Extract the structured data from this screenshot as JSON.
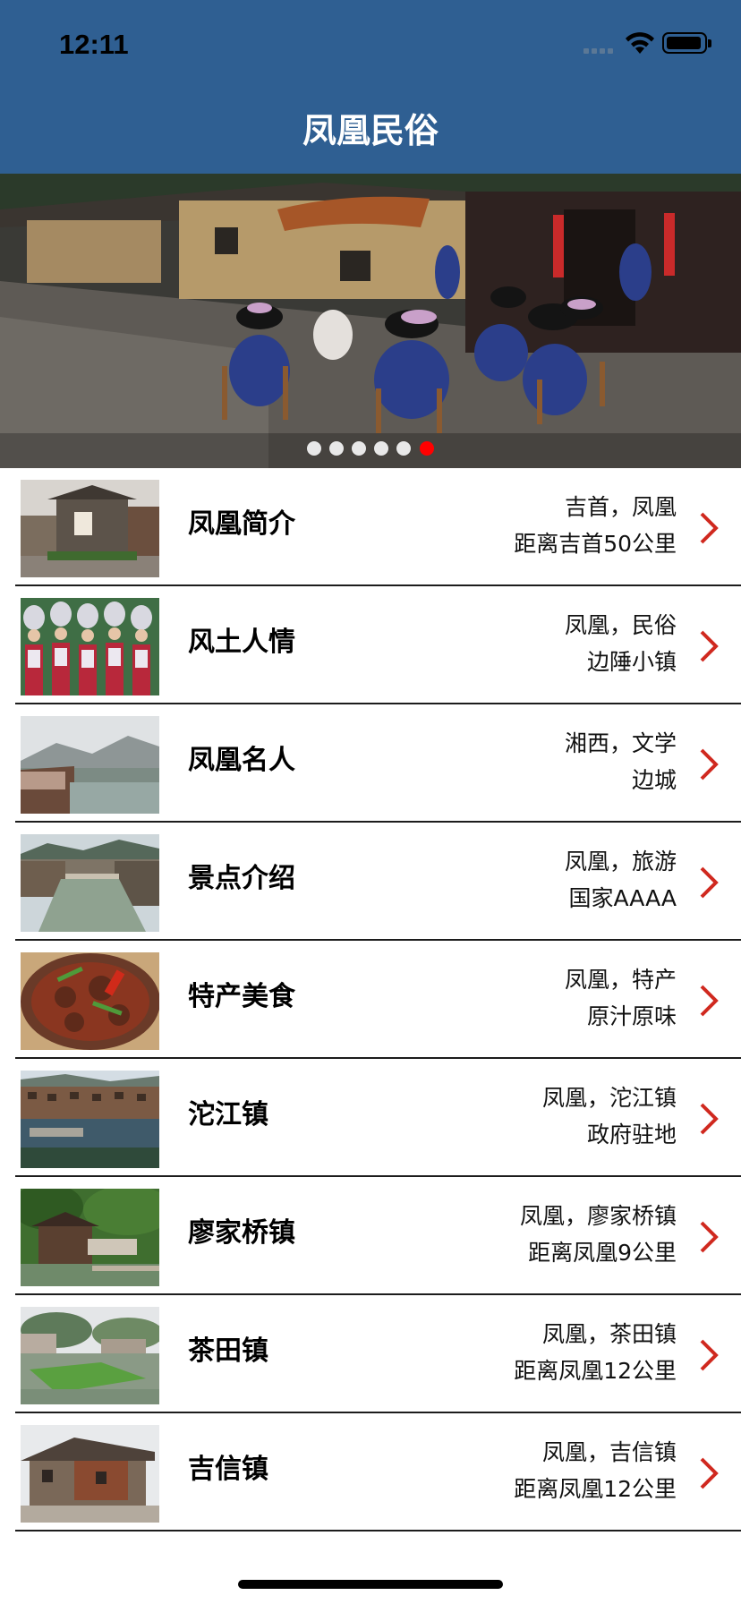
{
  "status_bar": {
    "time": "12:11"
  },
  "nav": {
    "title": "凤凰民俗"
  },
  "banner": {
    "total_slides": 6,
    "active_slide": 6,
    "active_color": "#ff0000",
    "dot_color": "#e8e8e8"
  },
  "colors": {
    "nav_bg": "#2f5f92",
    "chevron": "#d0291f"
  },
  "items": [
    {
      "title": "凤凰简介",
      "line1": "吉首，凤凰",
      "line2": "距离吉首50公里"
    },
    {
      "title": "风土人情",
      "line1": "凤凰，民俗",
      "line2": "边陲小镇"
    },
    {
      "title": "凤凰名人",
      "line1": "湘西，文学",
      "line2": "边城"
    },
    {
      "title": "景点介绍",
      "line1": "凤凰，旅游",
      "line2": "国家AAAA"
    },
    {
      "title": "特产美食",
      "line1": "凤凰，特产",
      "line2": "原汁原味"
    },
    {
      "title": "沱江镇",
      "line1": "凤凰，沱江镇",
      "line2": "政府驻地"
    },
    {
      "title": "廖家桥镇",
      "line1": "凤凰，廖家桥镇",
      "line2": "距离凤凰9公里"
    },
    {
      "title": "茶田镇",
      "line1": "凤凰，茶田镇",
      "line2": "距离凤凰12公里"
    },
    {
      "title": "吉信镇",
      "line1": "凤凰，吉信镇",
      "line2": "距离凤凰12公里"
    }
  ]
}
